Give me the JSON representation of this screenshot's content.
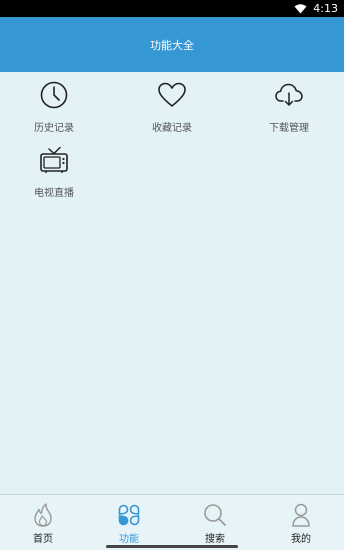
{
  "status_bar": {
    "time": "4:13"
  },
  "header": {
    "title": "功能大全"
  },
  "features": [
    {
      "label": "历史记录",
      "icon": "clock-icon"
    },
    {
      "label": "收藏记录",
      "icon": "heart-icon"
    },
    {
      "label": "下载管理",
      "icon": "cloud-download-icon"
    },
    {
      "label": "电视直播",
      "icon": "tv-icon"
    }
  ],
  "bottom_nav": {
    "items": [
      {
        "label": "首页",
        "icon": "flame-icon",
        "active": false
      },
      {
        "label": "功能",
        "icon": "grid-petals-icon",
        "active": true
      },
      {
        "label": "搜索",
        "icon": "search-icon",
        "active": false
      },
      {
        "label": "我的",
        "icon": "user-icon",
        "active": false
      }
    ]
  },
  "colors": {
    "accent": "#3597d3",
    "background": "#e3f2f7"
  }
}
